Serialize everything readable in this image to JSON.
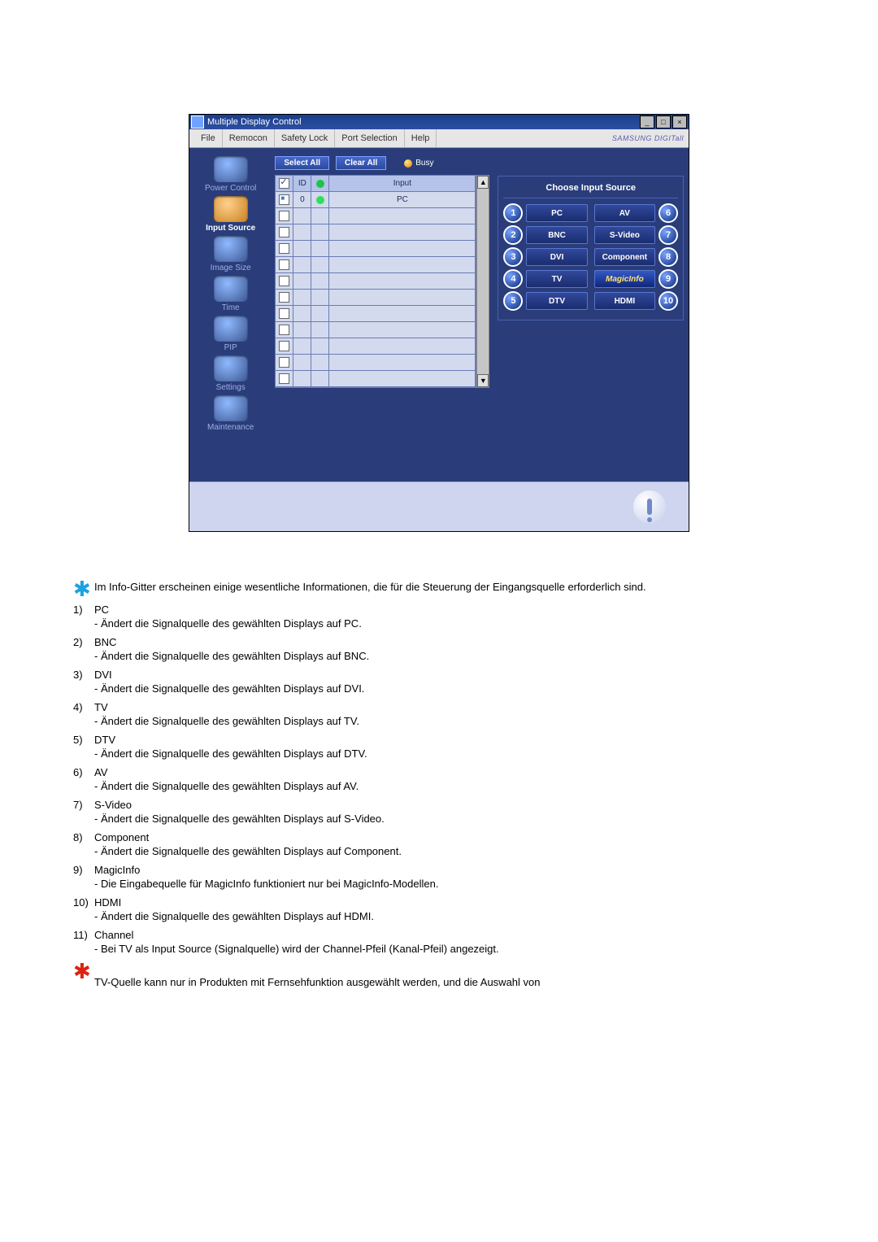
{
  "app": {
    "title": "Multiple Display Control",
    "menu": {
      "file": "File",
      "remocon": "Remocon",
      "safety": "Safety Lock",
      "port": "Port Selection",
      "help": "Help"
    },
    "brand": "SAMSUNG DIGITall",
    "sidebar": [
      {
        "name": "power-control",
        "label": "Power Control"
      },
      {
        "name": "input-source",
        "label": "Input Source"
      },
      {
        "name": "image-size",
        "label": "Image Size"
      },
      {
        "name": "time",
        "label": "Time"
      },
      {
        "name": "pip",
        "label": "PIP"
      },
      {
        "name": "settings",
        "label": "Settings"
      },
      {
        "name": "maintenance",
        "label": "Maintenance"
      }
    ],
    "toolbar": {
      "select_all": "Select All",
      "clear_all": "Clear All",
      "busy": "Busy"
    },
    "grid": {
      "head": {
        "id": "ID",
        "input": "Input"
      },
      "row0": {
        "id": "0",
        "input": "PC"
      }
    },
    "right": {
      "title": "Choose Input Source",
      "sources": {
        "s1": {
          "n": "1",
          "l": "PC"
        },
        "s6": {
          "n": "6",
          "l": "AV"
        },
        "s2": {
          "n": "2",
          "l": "BNC"
        },
        "s7": {
          "n": "7",
          "l": "S-Video"
        },
        "s3": {
          "n": "3",
          "l": "DVI"
        },
        "s8": {
          "n": "8",
          "l": "Component"
        },
        "s4": {
          "n": "4",
          "l": "TV"
        },
        "s9": {
          "n": "9",
          "l": "MagicInfo"
        },
        "s5": {
          "n": "5",
          "l": "DTV"
        },
        "s10": {
          "n": "10",
          "l": "HDMI"
        }
      }
    }
  },
  "doc": {
    "note": "Im Info-Gitter erscheinen einige wesentliche Informationen, die für die Steuerung der Eingangsquelle erforderlich sind.",
    "items": {
      "i1": {
        "n": "1)",
        "t": "PC",
        "d": "- Ändert die Signalquelle des gewählten Displays auf PC."
      },
      "i2": {
        "n": "2)",
        "t": "BNC",
        "d": "- Ändert die Signalquelle des gewählten Displays auf BNC."
      },
      "i3": {
        "n": "3)",
        "t": "DVI",
        "d": "- Ändert die Signalquelle des gewählten Displays auf DVI."
      },
      "i4": {
        "n": "4)",
        "t": "TV",
        "d": "- Ändert die Signalquelle des gewählten Displays auf TV."
      },
      "i5": {
        "n": "5)",
        "t": "DTV",
        "d": "- Ändert die Signalquelle des gewählten Displays auf DTV."
      },
      "i6": {
        "n": "6)",
        "t": "AV",
        "d": "- Ändert die Signalquelle des gewählten Displays auf AV."
      },
      "i7": {
        "n": "7)",
        "t": "S-Video",
        "d": "- Ändert die Signalquelle des gewählten Displays auf S-Video."
      },
      "i8": {
        "n": "8)",
        "t": "Component",
        "d": "- Ändert die Signalquelle des gewählten Displays auf Component."
      },
      "i9": {
        "n": "9)",
        "t": "MagicInfo",
        "d": "- Die Eingabequelle für MagicInfo funktioniert nur bei MagicInfo-Modellen."
      },
      "i10": {
        "n": "10)",
        "t": "HDMI",
        "d": "- Ändert die Signalquelle des gewählten Displays auf HDMI."
      },
      "i11": {
        "n": "11)",
        "t": "Channel",
        "d": "- Bei TV als Input Source (Signalquelle) wird der Channel-Pfeil (Kanal-Pfeil) angezeigt."
      }
    },
    "footnote": "TV-Quelle kann nur in Produkten mit Fernsehfunktion ausgewählt werden, und die Auswahl von"
  }
}
